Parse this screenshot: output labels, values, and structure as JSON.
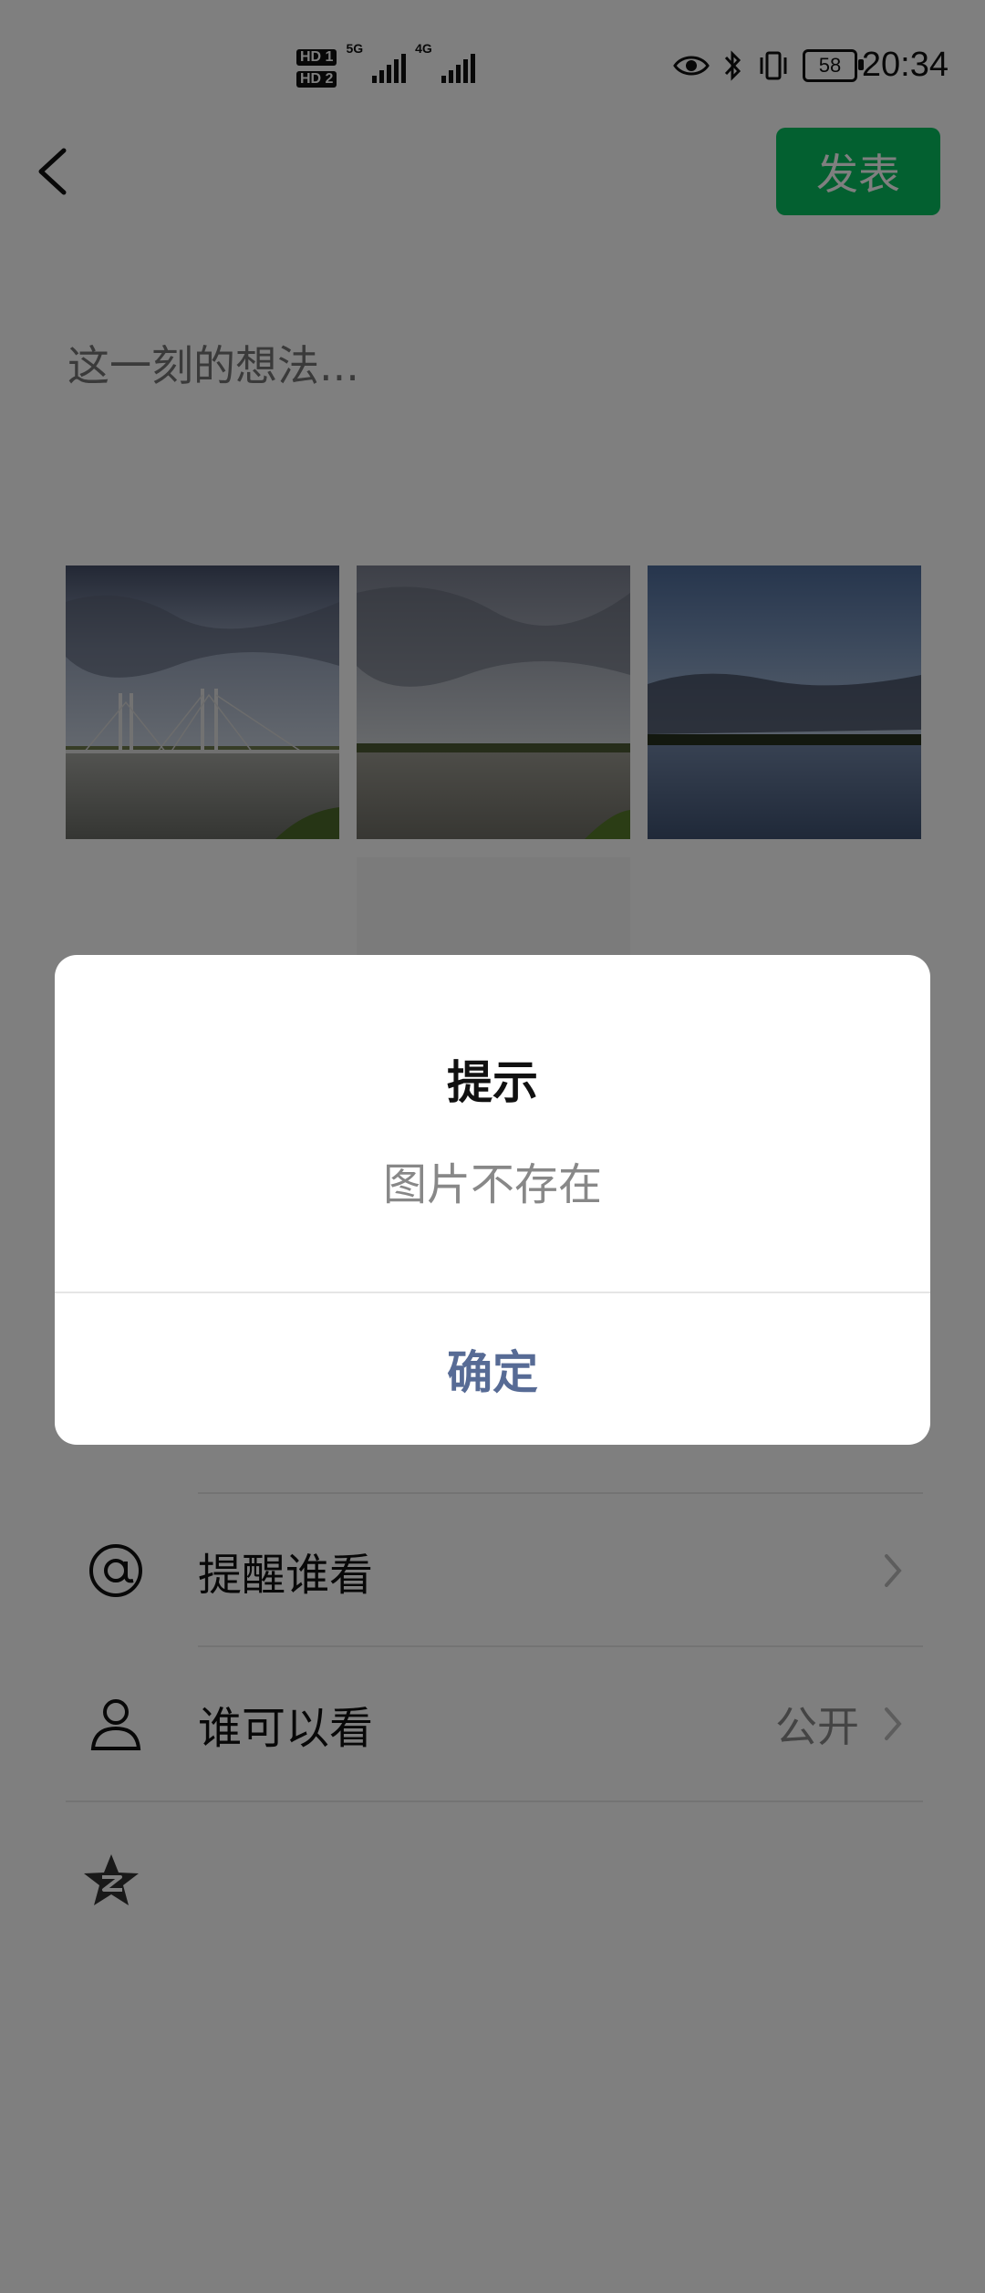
{
  "status_bar": {
    "time": "20:34",
    "battery": "58",
    "hd1": "HD 1",
    "hd2": "HD 2",
    "net1": "5G",
    "net2": "4G"
  },
  "toolbar": {
    "publish_label": "发表"
  },
  "compose": {
    "placeholder": "这一刻的想法..."
  },
  "rows": [
    {
      "label": "提醒谁看",
      "value": ""
    },
    {
      "label": "谁可以看",
      "value": "公开"
    }
  ],
  "dialog": {
    "title": "提示",
    "message": "图片不存在",
    "confirm": "确定"
  },
  "colors": {
    "accent": "#07c160",
    "link": "#576b95",
    "overlay": "rgba(0,0,0,0.5)"
  }
}
